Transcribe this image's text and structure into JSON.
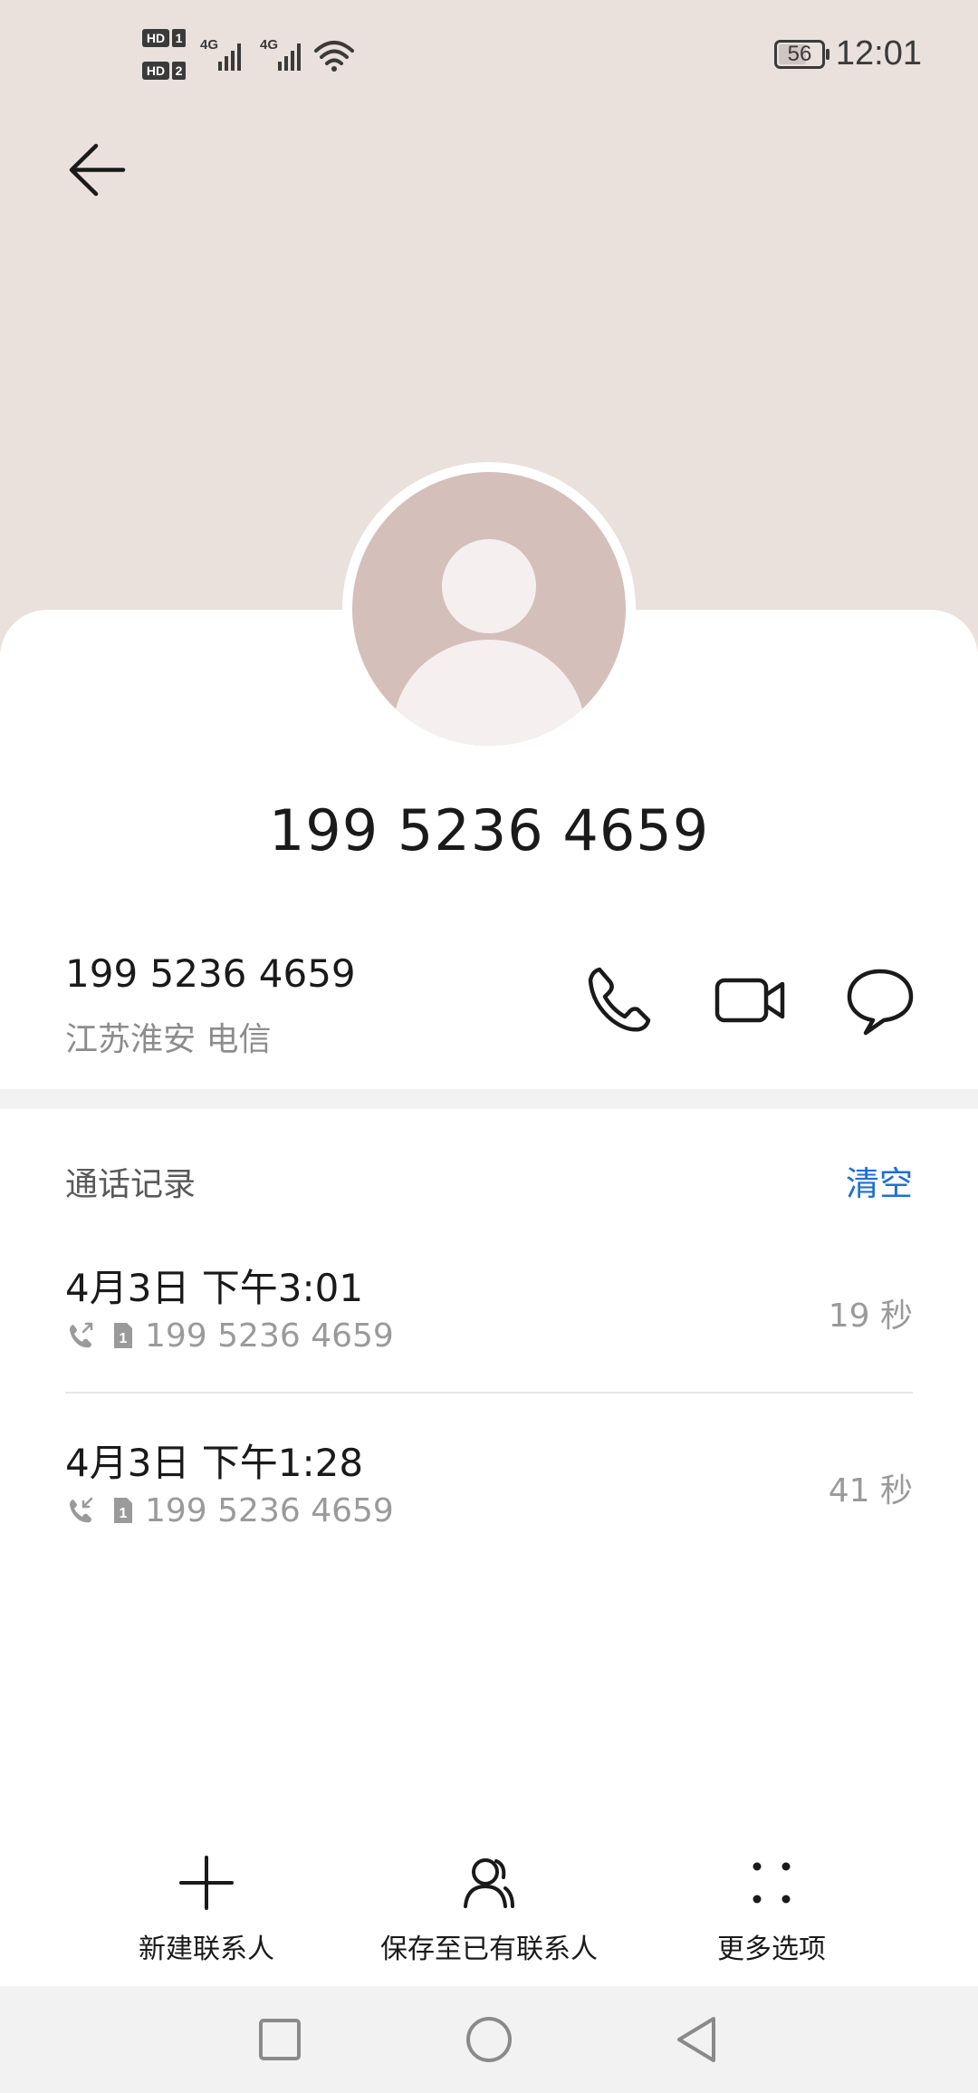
{
  "status_bar": {
    "time": "12:01",
    "battery": "56",
    "icons": [
      "hd-sim1-icon",
      "hd-sim2-icon",
      "signal-4g-icon",
      "signal-4g-icon",
      "wifi-icon"
    ]
  },
  "contact": {
    "title": "199 5236 4659",
    "number": "199 5236 4659",
    "location": "江苏淮安 电信"
  },
  "actions": {
    "call_icon": "phone-icon",
    "video_icon": "video-call-icon",
    "message_icon": "message-icon"
  },
  "call_log": {
    "title": "通话记录",
    "clear_label": "清空",
    "entries": [
      {
        "time": "4月3日 下午3:01",
        "number": "199 5236 4659",
        "duration": "19 秒",
        "type": "outgoing",
        "sim": "1"
      },
      {
        "time": "4月3日 下午1:28",
        "number": "199 5236 4659",
        "duration": "41 秒",
        "type": "incoming",
        "sim": "1"
      }
    ]
  },
  "bottom_bar": {
    "new_contact": "新建联系人",
    "save_existing": "保存至已有联系人",
    "more_options": "更多选项"
  },
  "colors": {
    "header_bg": "#eae0dc",
    "avatar_bg": "#d4bfba",
    "accent": "#1d6fd6"
  }
}
